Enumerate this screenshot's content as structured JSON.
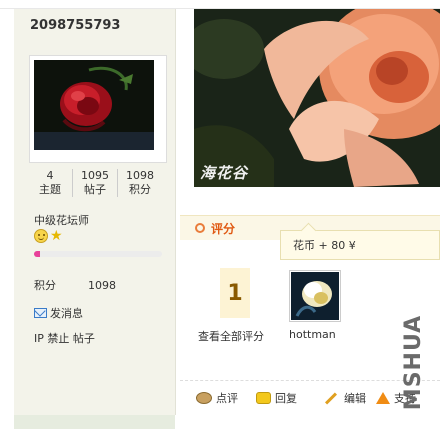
{
  "profile": {
    "username": "2098755793",
    "stats": [
      {
        "value": "4",
        "label": "主题"
      },
      {
        "value": "1095",
        "label": "帖子"
      },
      {
        "value": "1098",
        "label": "积分"
      }
    ],
    "level": "中级花坛师",
    "level_progress_percent": 5,
    "points_label": "积分",
    "points_value": "1098",
    "send_message": "发消息",
    "ip_ban_text": "IP 禁止 帖子"
  },
  "photo": {
    "watermark": "海花谷"
  },
  "rating": {
    "title": "评分",
    "tooltip": "花币 + 80 ¥",
    "count": "1",
    "view_all": "查看全部评分",
    "rater_name": "hottman"
  },
  "actions": {
    "comment": "点评",
    "reply": "回复",
    "edit": "编辑",
    "support": "支持"
  },
  "watermark_side": "MSHUA",
  "colors": {
    "sidebar_bg": "#f3f3ea",
    "rate_title": "#e05a14",
    "progress_fill": "#e8419a"
  }
}
